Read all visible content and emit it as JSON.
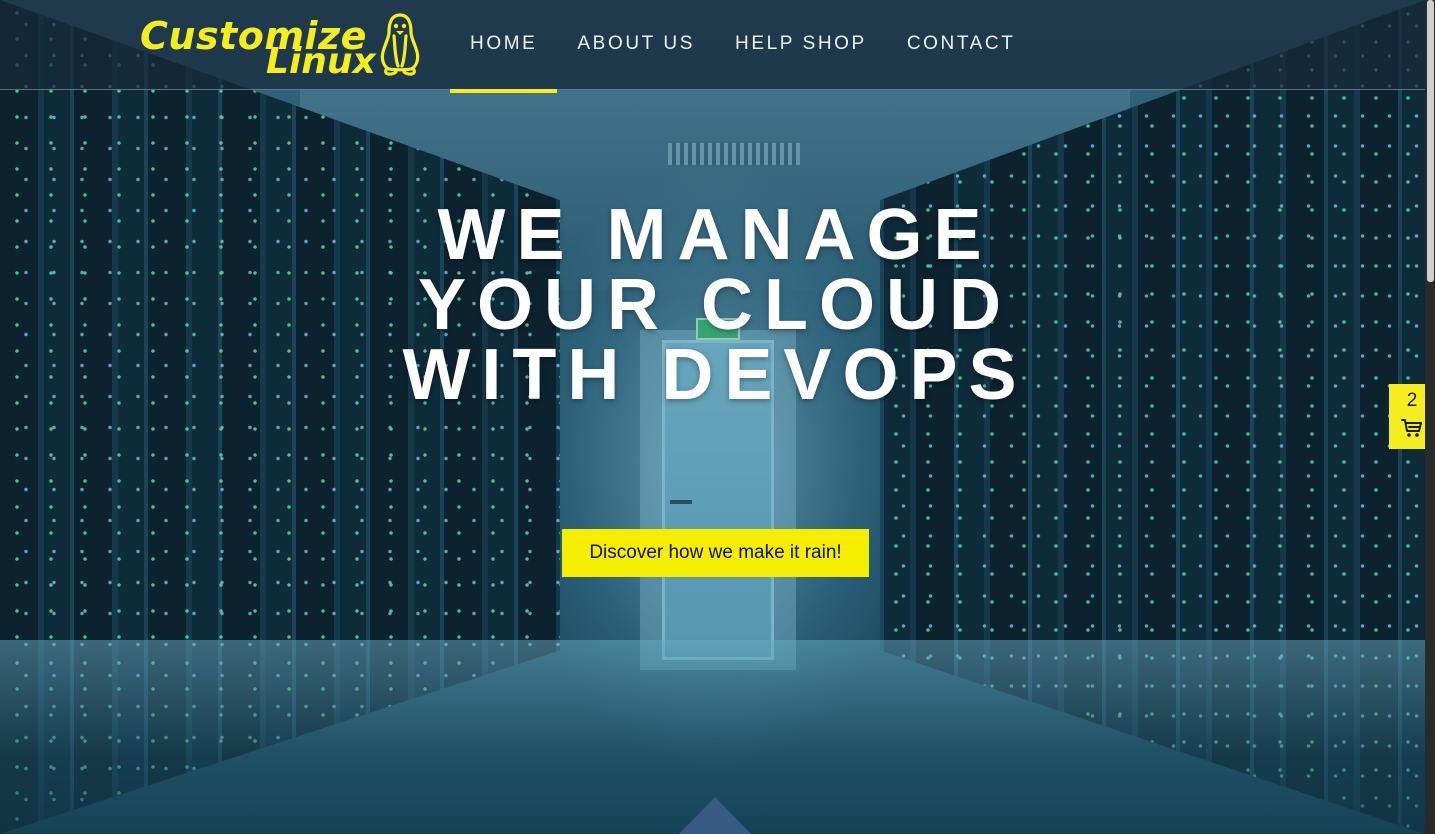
{
  "brand": {
    "logo_line1": "Customize",
    "logo_line2": "Linux",
    "accent_color": "#f6ee1c"
  },
  "nav": {
    "items": [
      {
        "label": "HOME",
        "active": true
      },
      {
        "label": "ABOUT US",
        "active": false
      },
      {
        "label": "HELP SHOP",
        "active": false
      },
      {
        "label": "CONTACT",
        "active": false
      }
    ]
  },
  "hero": {
    "headline_lines": [
      "WE MANAGE",
      "YOUR CLOUD",
      "WITH DEVOPS"
    ],
    "cta_label": "Discover how we make it rain!",
    "background": "server-room-aisle"
  },
  "cart": {
    "count": "2",
    "icon": "shopping-cart-icon"
  },
  "icons": {
    "logo_mascot": "tux-penguin-icon",
    "scroll_down": "scroll-down-arrow-icon"
  }
}
